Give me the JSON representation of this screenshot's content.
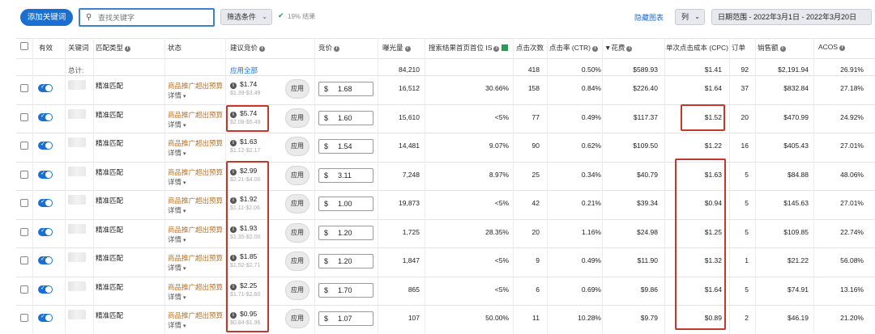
{
  "toolbar": {
    "add_keyword": "添加关键词",
    "search_placeholder": "查找关键字",
    "filter_label": "筛选条件",
    "result_text": "19% 结果",
    "hide_chart": "隐藏图表",
    "columns_label": "列",
    "date_range": "日期范围 - 2022年3月1日 - 2022年3月20日"
  },
  "headers": {
    "enabled": "有效",
    "keyword": "关键词",
    "match_type": "匹配类型",
    "status": "状态",
    "suggested_bid": "建议竞价",
    "bid": "竞价",
    "impressions": "曝光量",
    "top_of_search_is": "搜索结果首页首位 IS",
    "clicks": "点击次数",
    "ctr": "点击率 (CTR)",
    "spend": "▼花费",
    "cpc": "单次点击成本 (CPC)",
    "orders": "订单",
    "sales": "销售额",
    "acos": "ACOS"
  },
  "totals": {
    "label": "总计:",
    "apply_all": "应用全部",
    "impressions": "84,210",
    "clicks": "418",
    "ctr": "0.50%",
    "spend": "$589.93",
    "cpc": "$1.41",
    "orders": "92",
    "sales": "$2,191.94",
    "acos": "26.91%"
  },
  "row_common": {
    "match_type": "精准匹配",
    "status": "商品推广超出预算",
    "status_detail": "详情",
    "apply": "应用",
    "currency": "$"
  },
  "rows": [
    {
      "sugg": "$1.74",
      "range": "$1.39-$3.49",
      "bid": "1.68",
      "impr": "16,512",
      "tos": "30.66%",
      "clicks": "158",
      "ctr": "0.84%",
      "spend": "$226.40",
      "cpc": "$1.64",
      "orders": "37",
      "sales": "$832.84",
      "acos": "27.18%"
    },
    {
      "sugg": "$5.74",
      "range": "$2.08-$5.49",
      "bid": "1.60",
      "impr": "15,610",
      "tos": "<5%",
      "clicks": "77",
      "ctr": "0.49%",
      "spend": "$117.37",
      "cpc": "$1.52",
      "orders": "20",
      "sales": "$470.99",
      "acos": "24.92%"
    },
    {
      "sugg": "$1.63",
      "range": "$1.12-$2.17",
      "bid": "1.54",
      "impr": "14,481",
      "tos": "9.07%",
      "clicks": "90",
      "ctr": "0.62%",
      "spend": "$109.50",
      "cpc": "$1.22",
      "orders": "16",
      "sales": "$405.43",
      "acos": "27.01%"
    },
    {
      "sugg": "$2.99",
      "range": "$2.21-$4.00",
      "bid": "3.11",
      "impr": "7,248",
      "tos": "8.97%",
      "clicks": "25",
      "ctr": "0.34%",
      "spend": "$40.79",
      "cpc": "$1.63",
      "orders": "5",
      "sales": "$84.88",
      "acos": "48.06%"
    },
    {
      "sugg": "$1.92",
      "range": "$1.11-$2.06",
      "bid": "1.00",
      "impr": "19,873",
      "tos": "<5%",
      "clicks": "42",
      "ctr": "0.21%",
      "spend": "$39.34",
      "cpc": "$0.94",
      "orders": "5",
      "sales": "$145.63",
      "acos": "27.01%"
    },
    {
      "sugg": "$1.93",
      "range": "$1.35-$2.00",
      "bid": "1.20",
      "impr": "1,725",
      "tos": "28.35%",
      "clicks": "20",
      "ctr": "1.16%",
      "spend": "$24.98",
      "cpc": "$1.25",
      "orders": "5",
      "sales": "$109.85",
      "acos": "22.74%"
    },
    {
      "sugg": "$1.85",
      "range": "$1.52-$2.71",
      "bid": "1.20",
      "impr": "1,847",
      "tos": "<5%",
      "clicks": "9",
      "ctr": "0.49%",
      "spend": "$11.90",
      "cpc": "$1.32",
      "orders": "1",
      "sales": "$21.22",
      "acos": "56.08%"
    },
    {
      "sugg": "$2.25",
      "range": "$1.71-$2.60",
      "bid": "1.70",
      "impr": "865",
      "tos": "<5%",
      "clicks": "6",
      "ctr": "0.69%",
      "spend": "$9.86",
      "cpc": "$1.64",
      "orders": "5",
      "sales": "$74.91",
      "acos": "13.16%"
    },
    {
      "sugg": "$0.95",
      "range": "$0.84-$1.96",
      "bid": "1.07",
      "impr": "107",
      "tos": "50.00%",
      "clicks": "11",
      "ctr": "10.28%",
      "spend": "$9.79",
      "cpc": "$0.89",
      "orders": "2",
      "sales": "$46.19",
      "acos": "21.20%"
    }
  ],
  "colors": {
    "accent": "#1a6fd0",
    "highlight_box": "#c0392b",
    "status_text": "#b7712a"
  }
}
